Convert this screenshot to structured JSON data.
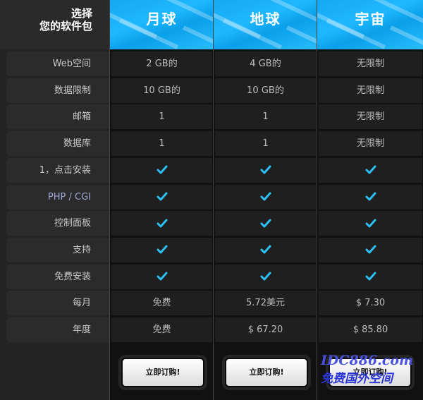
{
  "corner": {
    "line1": "选择",
    "line2": "您的软件包"
  },
  "plans": [
    {
      "name": "月球",
      "cells": [
        "2 GB的",
        "10 GB的",
        "1",
        "1",
        "check",
        "check",
        "check",
        "check",
        "check",
        "免费",
        "免费"
      ],
      "button": "立即订购!"
    },
    {
      "name": "地球",
      "cells": [
        "4 GB的",
        "10 GB的",
        "1",
        "1",
        "check",
        "check",
        "check",
        "check",
        "check",
        "5.72美元",
        "$ 67.20"
      ],
      "button": "立即订购!"
    },
    {
      "name": "宇宙",
      "cells": [
        "无限制",
        "无限制",
        "无限制",
        "无限制",
        "check",
        "check",
        "check",
        "check",
        "check",
        "$ 7.30",
        "$ 85.80"
      ],
      "button": "立即订购!"
    }
  ],
  "features": [
    "Web空间",
    "数据限制",
    "邮箱",
    "数据库",
    "1，点击安装",
    "PHP / CGI",
    "控制面板",
    "支持",
    "免费安装",
    "每月",
    "年度"
  ],
  "watermark": {
    "line1": "IDC886.com",
    "line2": "免费国外空间"
  },
  "colors": {
    "header_blue": "#1fb8ff",
    "check_blue": "#2cc0f5"
  }
}
